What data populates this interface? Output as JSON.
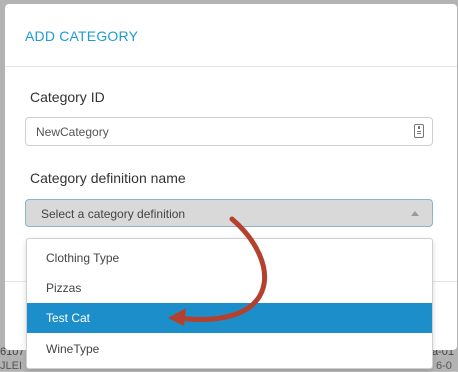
{
  "background": {
    "left_text": "6107",
    "left_text_2": "JLEI",
    "right_text": "a-01",
    "right_text_2": "6-0"
  },
  "modal": {
    "title": "ADD CATEGORY",
    "category_id_label": "Category ID",
    "category_id_value": "NewCategory",
    "definition_label": "Category definition name",
    "definition_placeholder": "Select a category definition"
  },
  "dropdown": {
    "options": [
      {
        "label": "Clothing Type",
        "selected": false
      },
      {
        "label": "Pizzas",
        "selected": false
      },
      {
        "label": "Test Cat",
        "selected": true
      },
      {
        "label": "WineType",
        "selected": false
      }
    ]
  },
  "colors": {
    "accent": "#1f9bd3",
    "selected_bg": "#1c8fca",
    "annotation_arrow": "#b5402e"
  }
}
